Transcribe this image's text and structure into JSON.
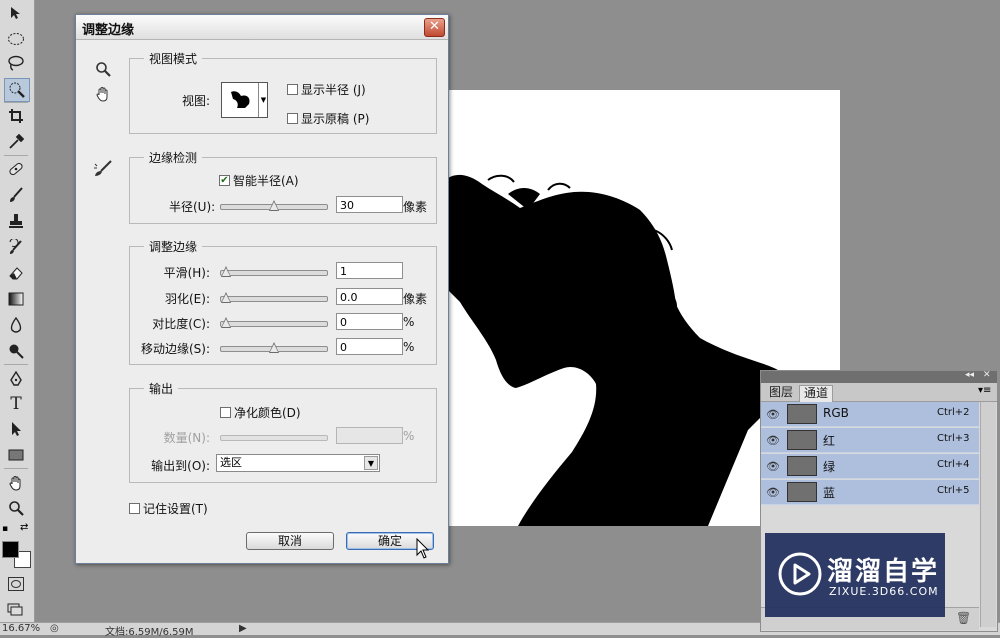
{
  "dialog": {
    "title": "调整边缘",
    "close_label": "✕",
    "view_mode": {
      "legend": "视图模式",
      "view_label": "视图:",
      "show_radius": "显示半径 (J)",
      "show_original": "显示原稿 (P)"
    },
    "edge_detection": {
      "legend": "边缘检测",
      "smart_radius": "智能半径(A)",
      "smart_radius_checked": true,
      "radius_label": "半径(U):",
      "radius_value": "30",
      "radius_unit": "像素",
      "radius_level": 0.5
    },
    "adjust_edge": {
      "legend": "调整边缘",
      "rows": [
        {
          "label": "平滑(H):",
          "value": "1",
          "unit": "",
          "level": 0.0
        },
        {
          "label": "羽化(E):",
          "value": "0.0",
          "unit": "像素",
          "level": 0.0
        },
        {
          "label": "对比度(C):",
          "value": "0",
          "unit": "%",
          "level": 0.0
        },
        {
          "label": "移动边缘(S):",
          "value": "0",
          "unit": "%",
          "level": 0.5
        }
      ]
    },
    "output": {
      "legend": "输出",
      "decontaminate": "净化颜色(D)",
      "amount_label": "数量(N):",
      "amount_value": "",
      "amount_unit": "%",
      "output_to_label": "输出到(O):",
      "output_to_value": "选区"
    },
    "remember": "记住设置(T)",
    "cancel": "取消",
    "ok": "确定"
  },
  "channels_panel": {
    "tabs": [
      "图层",
      "通道"
    ],
    "active_tab": "通道",
    "collapse_label": "◂◂",
    "close_label": "✕",
    "menu_label": "▾≡",
    "channels": [
      {
        "name": "RGB",
        "shortcut": "Ctrl+2"
      },
      {
        "name": "红",
        "shortcut": "Ctrl+3"
      },
      {
        "name": "绿",
        "shortcut": "Ctrl+4"
      },
      {
        "name": "蓝",
        "shortcut": "Ctrl+5"
      }
    ]
  },
  "status_bar": {
    "zoom": "16.67%",
    "doc_info": "文档:6.59M/6.59M"
  },
  "watermark": {
    "brand": "溜溜自学",
    "url": "ZIXUE.3D66.COM"
  },
  "toolbar": {
    "tools": [
      "move-icon",
      "marquee-icon",
      "lasso-icon",
      "quick-selection-icon",
      "crop-icon",
      "eyedropper-icon",
      "spot-healing-icon",
      "brush-icon",
      "clone-stamp-icon",
      "history-brush-icon",
      "eraser-icon",
      "gradient-icon",
      "blur-icon",
      "dodge-icon",
      "pen-icon",
      "type-icon",
      "path-selection-icon",
      "shape-icon",
      "hand-icon",
      "zoom-icon"
    ],
    "active_tool": "quick-selection-icon",
    "foreground_color": "#000000",
    "background_color": "#ffffff"
  }
}
